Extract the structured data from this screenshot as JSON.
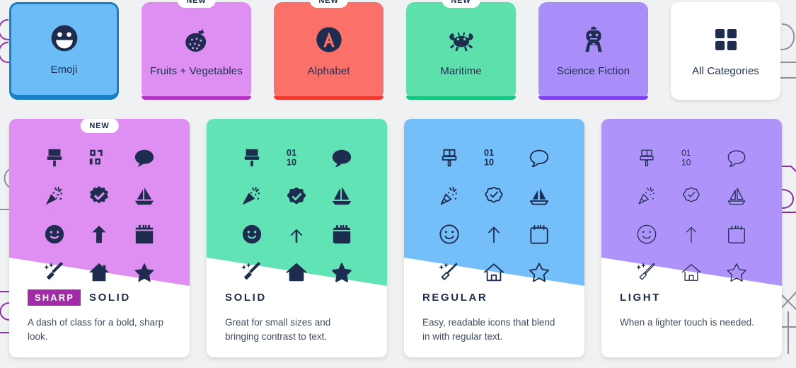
{
  "page": {
    "background_color": "#f0f1f2",
    "text_color": "#1e2d4f"
  },
  "categories": {
    "items": [
      {
        "label": "Emoji",
        "icon": "face-grin-icon",
        "color": "#6cbdf7",
        "accent_color": "#1a7fc4",
        "selected": true,
        "badge": null,
        "text_color": "#1e2d4f"
      },
      {
        "label": "Fruits + Vegetables",
        "icon": "strawberry-icon",
        "color": "#df8ef2",
        "accent_color": "#b431c5",
        "selected": false,
        "badge": "NEW",
        "text_color": "#1e2d4f"
      },
      {
        "label": "Alphabet",
        "icon": "circle-a-icon",
        "color": "#fb7069",
        "accent_color": "#f0382f",
        "selected": false,
        "badge": "NEW",
        "text_color": "#1e2d4f"
      },
      {
        "label": "Maritime",
        "icon": "crab-icon",
        "color": "#5ee0ad",
        "accent_color": "#16c380",
        "selected": false,
        "badge": "NEW",
        "text_color": "#1e2d4f"
      },
      {
        "label": "Science Fiction",
        "icon": "robot-icon",
        "color": "#a98df9",
        "accent_color": "#7c3ff2",
        "selected": false,
        "badge": null,
        "text_color": "#1e2d4f"
      },
      {
        "label": "All Categories",
        "icon": "grid-squares-icon",
        "color": "#ffffff",
        "accent_color": "#ffffff",
        "selected": false,
        "badge": null,
        "text_color": "#1e2d4f"
      }
    ]
  },
  "styles": {
    "icon_set": [
      "paintbrush-icon",
      "binary-icon",
      "comment-icon",
      "party-horn-icon",
      "badge-check-icon",
      "sailboat-icon",
      "face-smile-icon",
      "arrow-up-icon",
      "calendar-icon",
      "wand-sparkles-icon",
      "house-icon",
      "star-icon"
    ],
    "cards": [
      {
        "badge": "NEW",
        "prefix": "SHARP",
        "title": "SOLID",
        "description": "A dash of class for a bold, sharp look.",
        "color": "#df8ef2",
        "icon_color": "#1e2d4f",
        "badge_color": "#a32ba8",
        "variant": "sharp-solid"
      },
      {
        "badge": null,
        "prefix": null,
        "title": "SOLID",
        "description": "Great for small sizes and bringing contrast to text.",
        "color": "#61e3b6",
        "icon_color": "#1e2d4f",
        "badge_color": null,
        "variant": "solid"
      },
      {
        "badge": null,
        "prefix": null,
        "title": "REGULAR",
        "description": "Easy, readable icons that blend in with regular text.",
        "color": "#74bffa",
        "icon_color": "#1e2d4f",
        "badge_color": null,
        "variant": "regular"
      },
      {
        "badge": null,
        "prefix": null,
        "title": "LIGHT",
        "description": "When a lighter touch is needed.",
        "color": "#ae94fa",
        "icon_color": "#1e2d4f",
        "badge_color": null,
        "variant": "light"
      }
    ]
  }
}
